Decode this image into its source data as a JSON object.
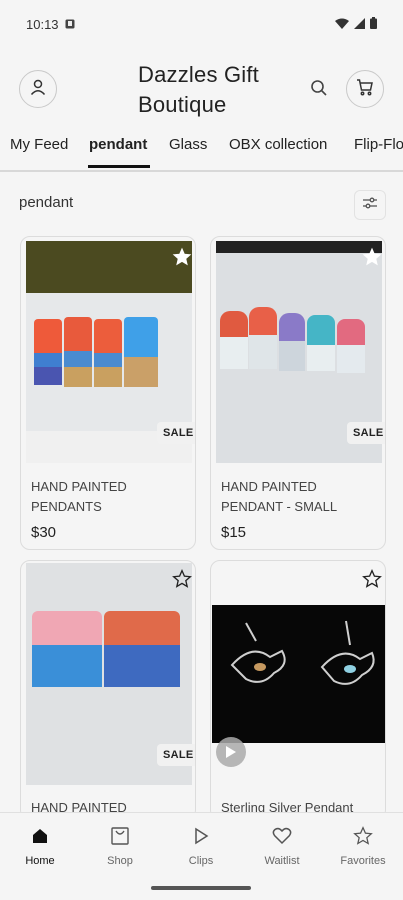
{
  "status_bar": {
    "time": "10:13"
  },
  "header": {
    "store_title": "Dazzles Gift Boutique"
  },
  "tabs": [
    {
      "label": "My Feed"
    },
    {
      "label": "pendant"
    },
    {
      "label": "Glass"
    },
    {
      "label": "OBX collection"
    },
    {
      "label": "Flip-Flo"
    }
  ],
  "active_tab": "pendant",
  "section": {
    "title": "pendant"
  },
  "products": [
    {
      "name": "HAND PAINTED PENDANTS",
      "price": "$30",
      "badge": "SALE",
      "favorited": true
    },
    {
      "name": "HAND PAINTED PENDANT - SMALL",
      "price": "$15",
      "badge": "SALE",
      "favorited": true
    },
    {
      "name": "HAND PAINTED",
      "price": "",
      "badge": "SALE",
      "favorited": false
    },
    {
      "name": "Sterling Silver Pendant",
      "price": "",
      "badge": "",
      "favorited": false
    }
  ],
  "bottom_nav": [
    {
      "label": "Home",
      "icon": "home-icon"
    },
    {
      "label": "Shop",
      "icon": "shop-icon"
    },
    {
      "label": "Clips",
      "icon": "play-icon"
    },
    {
      "label": "Waitlist",
      "icon": "heart-icon"
    },
    {
      "label": "Favorites",
      "icon": "star-icon"
    }
  ]
}
